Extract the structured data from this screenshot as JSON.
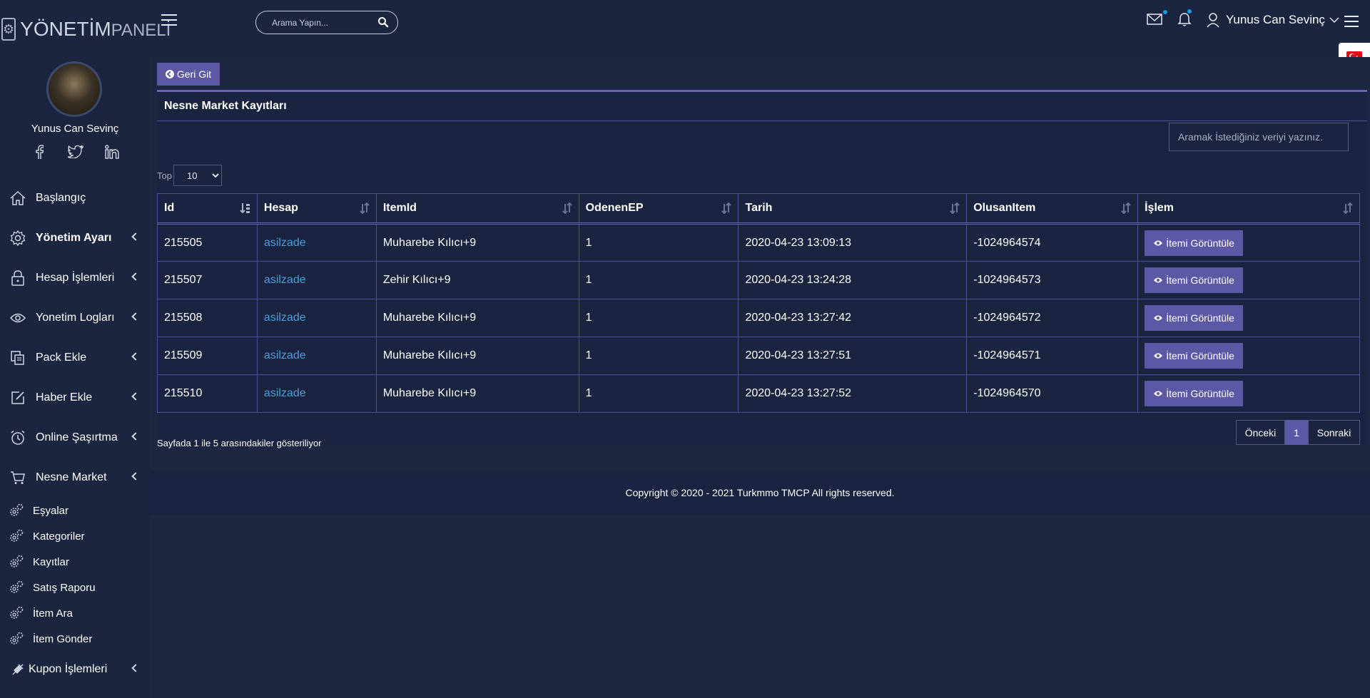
{
  "brand": {
    "logo_main": "YÖNETİM",
    "logo_thin": "PANELİ"
  },
  "header": {
    "search_placeholder": "Arama Yapın...",
    "user_name": "Yunus Can Sevinç"
  },
  "profile": {
    "name": "Yunus Can Sevinç"
  },
  "sidebar": {
    "items": [
      {
        "label": "Başlangıç",
        "icon": "home-icon",
        "bold": false,
        "has_chevron": false
      },
      {
        "label": "Yönetim Ayarı",
        "icon": "gear-icon",
        "bold": true,
        "has_chevron": true
      },
      {
        "label": "Hesap İşlemleri",
        "icon": "lock-icon",
        "bold": false,
        "has_chevron": true
      },
      {
        "label": "Yonetim Logları",
        "icon": "eye-icon",
        "bold": false,
        "has_chevron": true
      },
      {
        "label": "Pack Ekle",
        "icon": "copy-icon",
        "bold": false,
        "has_chevron": true
      },
      {
        "label": "Haber Ekle",
        "icon": "edit-icon",
        "bold": false,
        "has_chevron": true
      },
      {
        "label": "Online Şaşırtma",
        "icon": "alarm-clock-icon",
        "bold": false,
        "has_chevron": true
      },
      {
        "label": "Nesne Market",
        "icon": "cart-icon",
        "bold": false,
        "has_chevron": true
      }
    ],
    "sub_items": [
      {
        "label": "Eşyalar"
      },
      {
        "label": "Kategoriler"
      },
      {
        "label": "Kayıtlar"
      },
      {
        "label": "Satış Raporu"
      },
      {
        "label": "İtem Ara"
      },
      {
        "label": "İtem Gönder"
      }
    ],
    "last_item": {
      "label": "Kupon İşlemleri",
      "icon": "plug-icon"
    }
  },
  "main": {
    "back_label": "Geri Git",
    "card_title": "Nesne Market Kayıtları",
    "filter_placeholder": "Aramak İstediğiniz veriyi yazınız.",
    "length_label": "Top",
    "length_value": "10",
    "columns": [
      "Id",
      "Hesap",
      "ItemId",
      "OdenenEP",
      "Tarih",
      "OlusanItem",
      "İşlem"
    ],
    "rows": [
      {
        "id": "215505",
        "hesap": "asilzade",
        "item": "Muharebe Kılıcı+9",
        "ep": "1",
        "tarih": "2020-04-23 13:09:13",
        "olusan": "-1024964574",
        "action": "İtemi Görüntüle"
      },
      {
        "id": "215507",
        "hesap": "asilzade",
        "item": "Zehir Kılıcı+9",
        "ep": "1",
        "tarih": "2020-04-23 13:24:28",
        "olusan": "-1024964573",
        "action": "İtemi Görüntüle"
      },
      {
        "id": "215508",
        "hesap": "asilzade",
        "item": "Muharebe Kılıcı+9",
        "ep": "1",
        "tarih": "2020-04-23 13:27:42",
        "olusan": "-1024964572",
        "action": "İtemi Görüntüle"
      },
      {
        "id": "215509",
        "hesap": "asilzade",
        "item": "Muharebe Kılıcı+9",
        "ep": "1",
        "tarih": "2020-04-23 13:27:51",
        "olusan": "-1024964571",
        "action": "İtemi Görüntüle"
      },
      {
        "id": "215510",
        "hesap": "asilzade",
        "item": "Muharebe Kılıcı+9",
        "ep": "1",
        "tarih": "2020-04-23 13:27:52",
        "olusan": "-1024964570",
        "action": "İtemi Görüntüle"
      }
    ],
    "info_text": "Sayfada 1 ile 5 arasındakiler gösteriliyor",
    "pager": {
      "prev": "Önceki",
      "current": "1",
      "next": "Sonraki"
    }
  },
  "footer": {
    "copyright": "Copyright © 2020 - 2021 Turkmmo TMCP All rights reserved."
  },
  "colors": {
    "accent": "#5d58a6",
    "bg": "#1b2540",
    "link": "#4a9fd8",
    "badge_dot": "#0d9ee8"
  }
}
